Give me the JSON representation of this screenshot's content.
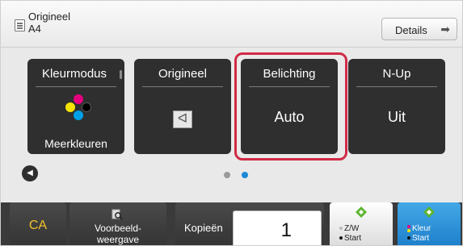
{
  "header": {
    "original_label": "Origineel",
    "original_size": "A4",
    "details_button": "Details",
    "details_arrow": "➡"
  },
  "tiles": [
    {
      "title": "Kleurmodus",
      "value": "",
      "sub": "Meerkleuren"
    },
    {
      "title": "Origineel",
      "value": "",
      "sub": "",
      "orientation_glyph": "ᐊ"
    },
    {
      "title": "Belichting",
      "value": "Auto",
      "sub": ""
    },
    {
      "title": "N-Up",
      "value": "Uit",
      "sub": ""
    }
  ],
  "nav": {
    "left_arrow": "◀",
    "page_indicator": {
      "pages": 2,
      "current": 2
    }
  },
  "bottom": {
    "clear_all": "CA",
    "preview_line1": "Voorbeeld-",
    "preview_line2": "weergave",
    "copies_label": "Kopieën",
    "copies_value": "1",
    "bw_start_line1": "Z/W",
    "bw_start_line2": "Start",
    "color_start_line1": "Kleur",
    "color_start_line2": "Start"
  },
  "colors": {
    "highlight": "#d12a45",
    "tile_bg": "#2f2f2f",
    "accent_blue": "#1e88d6",
    "start_green": "#5cb531",
    "clear_all_text": "#f3c12a"
  },
  "icons": {
    "document": "document-icon",
    "color_dots": "color-dots-icon",
    "magnifier": "preview-magnifier-icon",
    "start_diamond": "start-diamond-icon"
  }
}
